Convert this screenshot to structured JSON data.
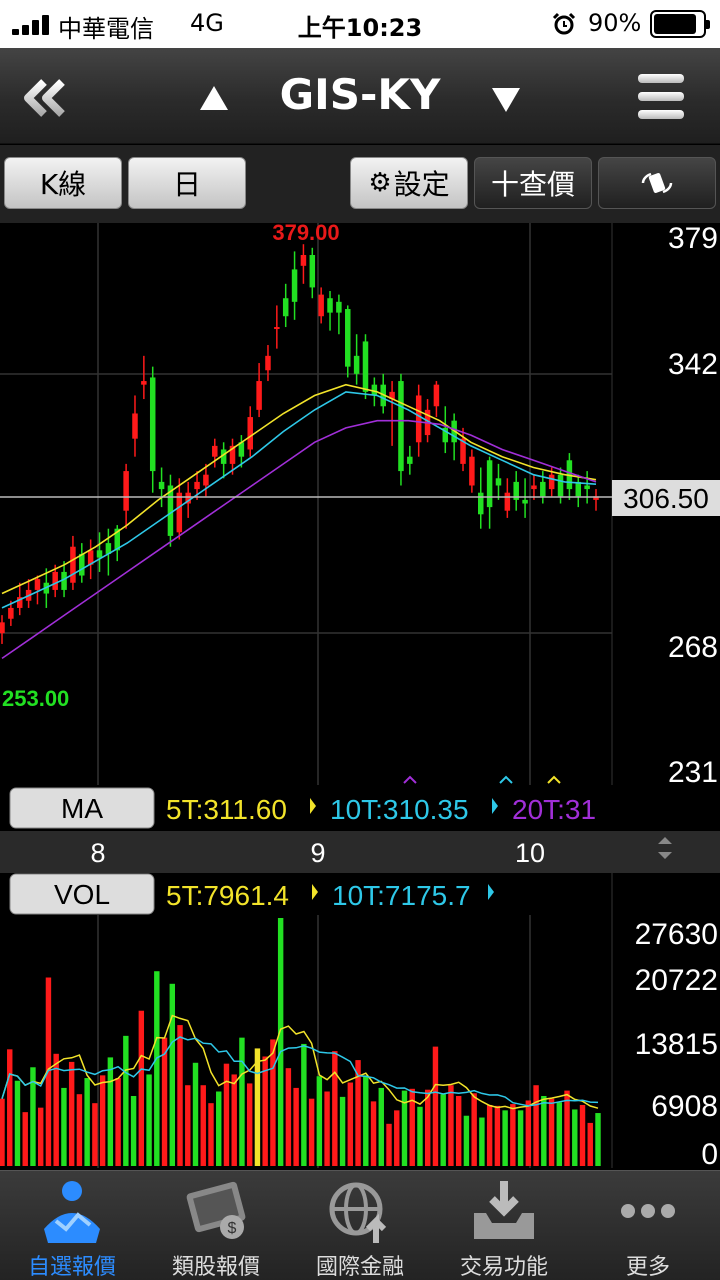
{
  "status_bar": {
    "carrier": "中華電信",
    "network": "4G",
    "time": "上午10:23",
    "battery": "90%",
    "battery_level": 0.9
  },
  "nav": {
    "title": "GIS-KY",
    "back_icon": "double-chevron-left-icon",
    "prev_icon": "triangle-up-icon",
    "next_icon": "triangle-down-icon",
    "menu_icon": "hamburger-menu-icon"
  },
  "toolbar": {
    "kline_label": "K線",
    "period_label": "日",
    "settings_label": "設定",
    "quote_label": "十查價",
    "rotate_icon": "rotate-icon"
  },
  "colors": {
    "up": "#ff1a1a",
    "down": "#22e022",
    "ma5": "#f2e32a",
    "ma10": "#2ec8e8",
    "ma20": "#a12fd8",
    "accent": "#2c8cff"
  },
  "price_chart": {
    "y_axis_ticks": [
      "379",
      "342",
      "268",
      "231"
    ],
    "current_price": "306.50",
    "high_label": "379.00",
    "low_label": "253.00",
    "x_axis_labels": [
      "8",
      "9",
      "10"
    ],
    "ma_button": "MA",
    "ma_values": {
      "ma5": "5T:311.60",
      "ma10": "10T:310.35",
      "ma20": "20T:31"
    }
  },
  "volume_chart": {
    "vol_button": "VOL",
    "vol_values": {
      "ma5": "5T:7961.4",
      "ma10": "10T:7175.7"
    },
    "y_axis_ticks": [
      "27630",
      "20722",
      "13815",
      "6908",
      "0"
    ]
  },
  "chart_data": [
    {
      "type": "candlestick",
      "x_axis_labels": [
        "8",
        "9",
        "10"
      ],
      "ylim": [
        231,
        379
      ],
      "high": 379.0,
      "low": 253.0,
      "current": 306.5,
      "candles": [
        [
          269,
          272,
          266,
          274
        ],
        [
          273,
          276,
          271,
          278
        ],
        [
          276,
          279,
          274,
          283
        ],
        [
          278,
          281,
          276,
          284
        ],
        [
          281,
          284,
          277,
          285
        ],
        [
          283,
          280,
          276,
          287
        ],
        [
          281,
          286,
          279,
          288
        ],
        [
          286,
          281,
          279,
          289
        ],
        [
          283,
          293,
          281,
          296
        ],
        [
          291,
          285,
          283,
          294
        ],
        [
          288,
          292,
          284,
          295
        ],
        [
          292,
          290,
          286,
          297
        ],
        [
          294,
          291,
          285,
          298
        ],
        [
          298,
          292,
          289,
          299
        ],
        [
          303,
          314,
          298,
          316
        ],
        [
          323,
          330,
          318,
          335
        ],
        [
          338,
          339,
          334,
          346
        ],
        [
          340,
          314,
          308,
          343
        ],
        [
          311,
          309,
          304,
          315
        ],
        [
          310,
          296,
          293,
          313
        ],
        [
          297,
          308,
          295,
          312
        ],
        [
          305,
          308,
          301,
          311
        ],
        [
          309,
          311,
          306,
          314
        ],
        [
          310,
          313,
          307,
          316
        ],
        [
          318,
          321,
          315,
          323
        ],
        [
          320,
          316,
          312,
          322
        ],
        [
          316,
          321,
          313,
          323
        ],
        [
          322,
          318,
          315,
          324
        ],
        [
          320,
          329,
          318,
          332
        ],
        [
          331,
          339,
          329,
          344
        ],
        [
          342,
          346,
          339,
          349
        ],
        [
          354,
          354,
          348,
          360
        ],
        [
          362,
          357,
          354,
          366
        ],
        [
          370,
          361,
          356,
          375
        ],
        [
          371,
          374,
          366,
          377
        ],
        [
          374,
          365,
          362,
          376
        ],
        [
          357,
          363,
          355,
          365
        ],
        [
          362,
          358,
          353,
          364
        ],
        [
          361,
          358,
          352,
          363
        ],
        [
          359,
          343,
          340,
          360
        ],
        [
          346,
          341,
          338,
          352
        ],
        [
          350,
          336,
          334,
          352
        ],
        [
          338,
          335,
          332,
          340
        ],
        [
          338,
          332,
          330,
          341
        ],
        [
          334,
          336,
          321,
          339
        ],
        [
          339,
          314,
          310,
          341
        ],
        [
          318,
          316,
          313,
          321
        ],
        [
          322,
          335,
          318,
          338
        ],
        [
          324,
          331,
          322,
          334
        ],
        [
          332,
          338,
          329,
          339
        ],
        [
          326,
          322,
          319,
          332
        ],
        [
          328,
          322,
          317,
          330
        ],
        [
          316,
          323,
          314,
          326
        ],
        [
          310,
          318,
          308,
          320
        ],
        [
          308,
          302,
          298,
          315
        ],
        [
          317,
          304,
          298,
          318
        ],
        [
          312,
          310,
          306,
          316
        ],
        [
          303,
          308,
          301,
          312
        ],
        [
          311,
          306,
          303,
          314
        ],
        [
          306,
          305,
          301,
          312
        ],
        [
          309,
          310,
          306,
          313
        ],
        [
          311,
          307,
          305,
          314
        ],
        [
          309,
          313,
          307,
          315
        ],
        [
          313,
          307,
          305,
          315
        ],
        [
          317,
          309,
          306,
          319
        ],
        [
          311,
          307,
          304,
          313
        ],
        [
          310,
          309,
          305,
          314
        ],
        [
          306,
          307,
          303,
          309
        ]
      ],
      "ma": {
        "5T": [
          280,
          284,
          288,
          293,
          299,
          306,
          312,
          318,
          324,
          330,
          335,
          338,
          336,
          332,
          328,
          322,
          318,
          315,
          313,
          311.6
        ],
        "10T": [
          276,
          280,
          284,
          289,
          294,
          300,
          306,
          312,
          318,
          325,
          331,
          336,
          335,
          331,
          326,
          321,
          317,
          313,
          311,
          310.35
        ],
        "20T": [
          262,
          268,
          274,
          280,
          286,
          292,
          298,
          304,
          310,
          316,
          322,
          326,
          328,
          328,
          327,
          324,
          320,
          317,
          314,
          311
        ]
      }
    },
    {
      "type": "bar",
      "title": "VOL",
      "ylim": [
        0,
        27630
      ],
      "values": [
        7500,
        13000,
        9500,
        6000,
        11000,
        6500,
        21000,
        12500,
        8700,
        11600,
        8000,
        9800,
        7000,
        10100,
        12100,
        9800,
        14500,
        7800,
        17300,
        10200,
        21700,
        14300,
        20300,
        15700,
        9000,
        11500,
        9000,
        7000,
        8300,
        11400,
        10200,
        14300,
        9200,
        13100,
        12200,
        14100,
        27630,
        10900,
        8700,
        13600,
        7500,
        10000,
        8300,
        12800,
        7700,
        9300,
        11800,
        10100,
        7200,
        8700,
        4700,
        6200,
        8400,
        8600,
        6600,
        8500,
        13300,
        8000,
        9000,
        7800,
        5600,
        8100,
        5400,
        6800,
        6700,
        6200,
        6900,
        6200,
        7300,
        9000,
        7800,
        7500,
        7100,
        8400,
        6300,
        6800,
        4800,
        5900
      ],
      "up_flags": [
        1,
        1,
        0,
        1,
        0,
        1,
        1,
        1,
        0,
        1,
        1,
        0,
        1,
        1,
        0,
        1,
        0,
        0,
        1,
        0,
        0,
        1,
        0,
        1,
        1,
        0,
        1,
        1,
        0,
        1,
        1,
        0,
        1,
        0,
        1,
        1,
        0,
        1,
        1,
        0,
        1,
        0,
        1,
        1,
        0,
        1,
        1,
        0,
        1,
        0,
        1,
        1,
        0,
        1,
        0,
        1,
        1,
        0,
        1,
        1,
        0,
        1,
        0,
        1,
        1,
        0,
        1,
        0,
        1,
        1,
        0,
        1,
        0,
        1,
        0,
        1,
        1,
        0
      ],
      "ma": {
        "5T": [
          7961.4
        ],
        "10T": [
          7175.7
        ]
      }
    }
  ],
  "tabs": [
    {
      "label": "自選報價",
      "icon": "watchlist-person-icon",
      "active": true
    },
    {
      "label": "類股報價",
      "icon": "film-reel-icon",
      "active": false
    },
    {
      "label": "國際金融",
      "icon": "globe-upload-icon",
      "active": false
    },
    {
      "label": "交易功能",
      "icon": "inbox-download-icon",
      "active": false
    },
    {
      "label": "更多",
      "icon": "more-dots-icon",
      "active": false
    }
  ]
}
